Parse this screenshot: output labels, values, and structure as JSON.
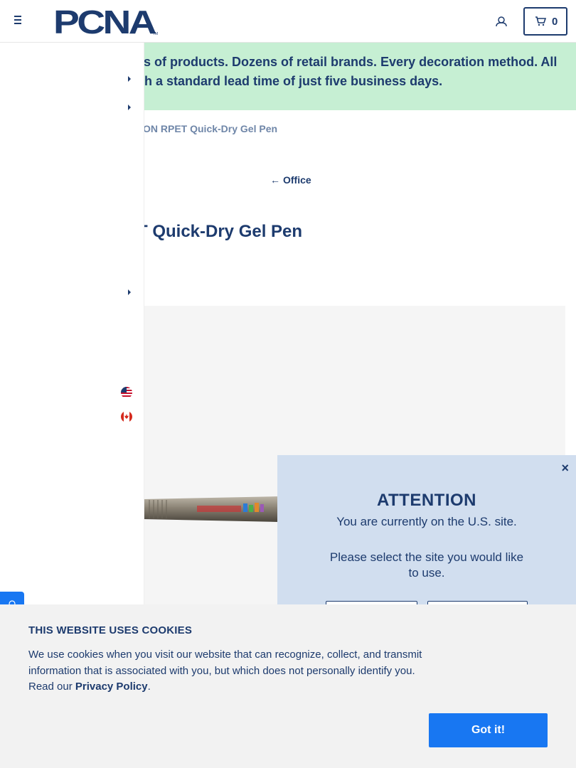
{
  "header": {
    "logo_text": "PCNA",
    "cart_count": "0"
  },
  "banner": {
    "line1": "ls of products. Dozens of retail brands. Every decoration method. All",
    "line2": "th a standard lead time of just five business days."
  },
  "breadcrumb": {
    "current": "ON RPET Quick-Dry Gel Pen"
  },
  "back_link": {
    "label": "Office"
  },
  "product": {
    "title": "T Quick-Dry Gel Pen"
  },
  "attention_modal": {
    "close": "×",
    "title": "ATTENTION",
    "subtitle": "You are currently on the U.S. site.",
    "prompt": "Please select the site you would like to use."
  },
  "cookie_banner": {
    "title": "THIS WEBSITE USES COOKIES",
    "text": "We use cookies when you visit our website that can recognize, collect, and transmit information that is associated with you, but which does not personally identify you. Read our ",
    "link": "Privacy Policy",
    "text_end": ".",
    "button": "Got it!"
  },
  "colors": {
    "brand_navy": "#1d3b6e",
    "accent_blue": "#1877f2",
    "banner_green": "#c6efd3",
    "modal_blue": "#d1deef"
  }
}
